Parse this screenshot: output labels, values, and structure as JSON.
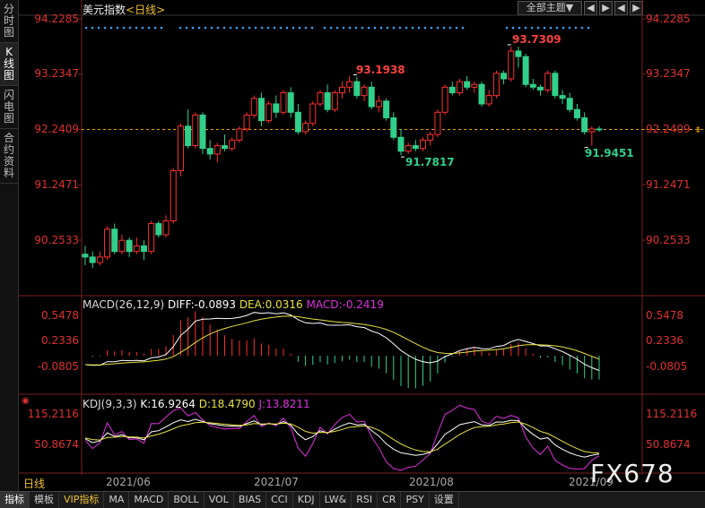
{
  "sidebar": {
    "tabs": [
      {
        "label": "分时图",
        "active": false
      },
      {
        "label": "K线图",
        "active": true
      },
      {
        "label": "闪电图",
        "active": false
      },
      {
        "label": "合约资料",
        "active": false
      }
    ]
  },
  "header": {
    "title": "美元指数",
    "period_tag": "<日线>",
    "all_topics": "全部主题▼",
    "nav_buttons": [
      "◀",
      "▶",
      "◀",
      "▶"
    ]
  },
  "price_axis": {
    "labels": [
      "94.2285",
      "93.2347",
      "92.2409",
      "91.2471",
      "90.2533"
    ],
    "current_line": "92.2409"
  },
  "annotations": {
    "high1": "93.1938",
    "high2": "93.7309",
    "low1": "91.7817",
    "low2": "91.9451"
  },
  "macd": {
    "name": "MACD(26,12,9)",
    "diff": "DIFF:-0.0893",
    "dea": "DEA:0.0316",
    "macd": "MACD:-0.2419",
    "axis": [
      "0.5478",
      "0.2336",
      "-0.0805"
    ]
  },
  "kdj": {
    "name": "KDJ(9,3,3)",
    "k": "K:16.9264",
    "d": "D:18.4790",
    "j": "J:13.8211",
    "axis": [
      "115.2116",
      "50.8674"
    ]
  },
  "x_axis": [
    "2021/06",
    "2021/07",
    "2021/08",
    "2021/09"
  ],
  "period": "日线",
  "bottom_tabs": [
    {
      "label": "指标",
      "active": true,
      "vip": false
    },
    {
      "label": "模板",
      "active": false,
      "vip": false
    },
    {
      "label": "VIP指标",
      "active": false,
      "vip": true
    },
    {
      "label": "MA",
      "active": false,
      "vip": false
    },
    {
      "label": "MACD",
      "active": false,
      "vip": false
    },
    {
      "label": "BOLL",
      "active": false,
      "vip": false
    },
    {
      "label": "VOL",
      "active": false,
      "vip": false
    },
    {
      "label": "BIAS",
      "active": false,
      "vip": false
    },
    {
      "label": "CCI",
      "active": false,
      "vip": false
    },
    {
      "label": "KDJ",
      "active": false,
      "vip": false
    },
    {
      "label": "LW&",
      "active": false,
      "vip": false
    },
    {
      "label": "RSI",
      "active": false,
      "vip": false
    },
    {
      "label": "CR",
      "active": false,
      "vip": false
    },
    {
      "label": "PSY",
      "active": false,
      "vip": false
    },
    {
      "label": "设置",
      "active": false,
      "vip": false
    }
  ],
  "watermark": "FX678",
  "colors": {
    "up": "#ff3030",
    "down": "#30d08a",
    "diff_line": "#ffffff",
    "dea_line": "#e8e040",
    "kdj_j": "#e030e0",
    "grid": "#7a2020"
  },
  "candles": [
    [
      90.0,
      90.15,
      89.8,
      89.95
    ],
    [
      89.95,
      90.05,
      89.75,
      89.85
    ],
    [
      89.85,
      90.05,
      89.8,
      89.95
    ],
    [
      89.95,
      90.5,
      89.9,
      90.45
    ],
    [
      90.45,
      90.55,
      90.0,
      90.05
    ],
    [
      90.05,
      90.35,
      90.0,
      90.25
    ],
    [
      90.25,
      90.3,
      89.95,
      90.05
    ],
    [
      90.05,
      90.3,
      90.0,
      90.15
    ],
    [
      90.15,
      90.25,
      89.9,
      90.05
    ],
    [
      90.05,
      90.6,
      90.0,
      90.55
    ],
    [
      90.55,
      90.6,
      90.3,
      90.35
    ],
    [
      90.35,
      90.7,
      90.3,
      90.6
    ],
    [
      90.6,
      91.55,
      90.55,
      91.5
    ],
    [
      91.5,
      92.35,
      91.4,
      92.3
    ],
    [
      92.3,
      92.6,
      91.9,
      91.95
    ],
    [
      91.95,
      92.55,
      91.9,
      92.5
    ],
    [
      92.5,
      92.55,
      91.8,
      91.9
    ],
    [
      91.9,
      92.05,
      91.7,
      91.8
    ],
    [
      91.8,
      92.0,
      91.65,
      91.95
    ],
    [
      91.95,
      92.15,
      91.85,
      91.9
    ],
    [
      91.9,
      92.1,
      91.85,
      92.05
    ],
    [
      92.05,
      92.3,
      92.0,
      92.25
    ],
    [
      92.25,
      92.55,
      92.2,
      92.5
    ],
    [
      92.5,
      92.85,
      92.45,
      92.8
    ],
    [
      92.8,
      92.9,
      92.3,
      92.4
    ],
    [
      92.4,
      92.75,
      92.35,
      92.7
    ],
    [
      92.7,
      92.85,
      92.45,
      92.55
    ],
    [
      92.55,
      92.95,
      92.5,
      92.9
    ],
    [
      92.9,
      93.0,
      92.45,
      92.55
    ],
    [
      92.55,
      92.7,
      92.15,
      92.2
    ],
    [
      92.2,
      92.4,
      92.15,
      92.35
    ],
    [
      92.35,
      92.75,
      92.3,
      92.7
    ],
    [
      92.7,
      92.95,
      92.65,
      92.9
    ],
    [
      92.9,
      93.05,
      92.55,
      92.6
    ],
    [
      92.6,
      92.95,
      92.55,
      92.9
    ],
    [
      92.9,
      93.1,
      92.8,
      93.0
    ],
    [
      93.0,
      93.2,
      92.9,
      93.1
    ],
    [
      93.1,
      93.19,
      92.8,
      92.85
    ],
    [
      92.85,
      93.05,
      92.75,
      93.0
    ],
    [
      93.0,
      93.1,
      92.6,
      92.65
    ],
    [
      92.65,
      92.85,
      92.55,
      92.75
    ],
    [
      92.75,
      92.8,
      92.4,
      92.45
    ],
    [
      92.45,
      92.55,
      92.05,
      92.1
    ],
    [
      92.1,
      92.25,
      91.78,
      91.85
    ],
    [
      91.85,
      92.0,
      91.8,
      91.95
    ],
    [
      91.95,
      92.05,
      91.85,
      91.9
    ],
    [
      91.9,
      92.1,
      91.85,
      92.05
    ],
    [
      92.05,
      92.2,
      91.95,
      92.15
    ],
    [
      92.15,
      92.6,
      92.1,
      92.55
    ],
    [
      92.55,
      93.05,
      92.5,
      93.0
    ],
    [
      93.0,
      93.1,
      92.85,
      92.9
    ],
    [
      92.9,
      93.15,
      92.85,
      93.1
    ],
    [
      93.1,
      93.2,
      92.95,
      93.0
    ],
    [
      93.0,
      93.1,
      92.9,
      93.05
    ],
    [
      93.05,
      93.1,
      92.65,
      92.7
    ],
    [
      92.7,
      92.95,
      92.65,
      92.85
    ],
    [
      92.85,
      93.3,
      92.8,
      93.25
    ],
    [
      93.25,
      93.3,
      93.05,
      93.15
    ],
    [
      93.15,
      93.73,
      93.1,
      93.65
    ],
    [
      93.65,
      93.73,
      93.35,
      93.55
    ],
    [
      93.55,
      93.6,
      93.0,
      93.05
    ],
    [
      93.05,
      93.15,
      92.95,
      93.0
    ],
    [
      93.0,
      93.05,
      92.85,
      92.95
    ],
    [
      92.95,
      93.3,
      92.9,
      93.25
    ],
    [
      93.25,
      93.3,
      92.8,
      92.85
    ],
    [
      92.85,
      92.95,
      92.7,
      92.8
    ],
    [
      92.8,
      92.9,
      92.55,
      92.6
    ],
    [
      92.6,
      92.7,
      92.4,
      92.45
    ],
    [
      92.45,
      92.55,
      92.15,
      92.2
    ],
    [
      92.2,
      92.3,
      91.95,
      92.25
    ],
    [
      92.25,
      92.3,
      92.2,
      92.24
    ]
  ]
}
